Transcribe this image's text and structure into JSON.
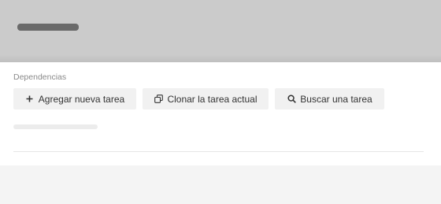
{
  "section": {
    "label": "Dependencias"
  },
  "actions": {
    "add": {
      "label": "Agregar nueva tarea",
      "icon": "plus-icon"
    },
    "clone": {
      "label": "Clonar la tarea actual",
      "icon": "copy-icon"
    },
    "search": {
      "label": "Buscar una tarea",
      "icon": "search-icon"
    }
  },
  "colors": {
    "header_bg": "#cbcbcb",
    "panel_bg": "#ffffff",
    "button_bg": "#f1f1f1",
    "text": "#333333",
    "muted_text": "#8a8a8a"
  }
}
